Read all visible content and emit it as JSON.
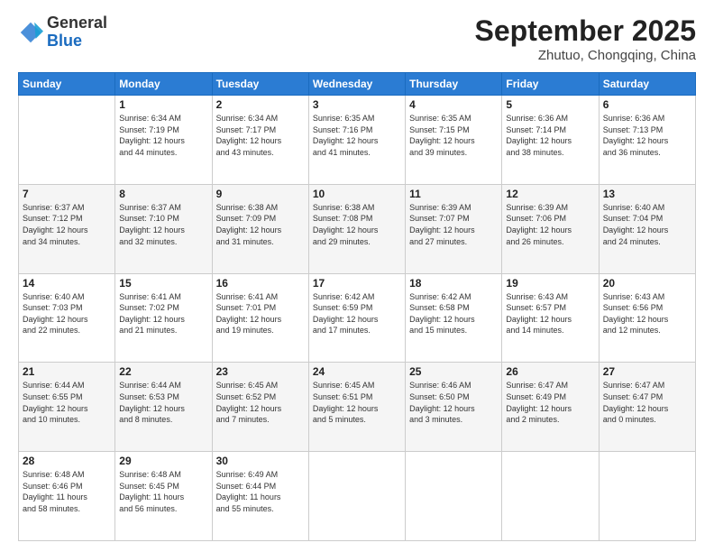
{
  "header": {
    "logo_general": "General",
    "logo_blue": "Blue",
    "month_year": "September 2025",
    "location": "Zhutuo, Chongqing, China"
  },
  "weekdays": [
    "Sunday",
    "Monday",
    "Tuesday",
    "Wednesday",
    "Thursday",
    "Friday",
    "Saturday"
  ],
  "weeks": [
    [
      {
        "day": "",
        "info": ""
      },
      {
        "day": "1",
        "info": "Sunrise: 6:34 AM\nSunset: 7:19 PM\nDaylight: 12 hours\nand 44 minutes."
      },
      {
        "day": "2",
        "info": "Sunrise: 6:34 AM\nSunset: 7:17 PM\nDaylight: 12 hours\nand 43 minutes."
      },
      {
        "day": "3",
        "info": "Sunrise: 6:35 AM\nSunset: 7:16 PM\nDaylight: 12 hours\nand 41 minutes."
      },
      {
        "day": "4",
        "info": "Sunrise: 6:35 AM\nSunset: 7:15 PM\nDaylight: 12 hours\nand 39 minutes."
      },
      {
        "day": "5",
        "info": "Sunrise: 6:36 AM\nSunset: 7:14 PM\nDaylight: 12 hours\nand 38 minutes."
      },
      {
        "day": "6",
        "info": "Sunrise: 6:36 AM\nSunset: 7:13 PM\nDaylight: 12 hours\nand 36 minutes."
      }
    ],
    [
      {
        "day": "7",
        "info": "Sunrise: 6:37 AM\nSunset: 7:12 PM\nDaylight: 12 hours\nand 34 minutes."
      },
      {
        "day": "8",
        "info": "Sunrise: 6:37 AM\nSunset: 7:10 PM\nDaylight: 12 hours\nand 32 minutes."
      },
      {
        "day": "9",
        "info": "Sunrise: 6:38 AM\nSunset: 7:09 PM\nDaylight: 12 hours\nand 31 minutes."
      },
      {
        "day": "10",
        "info": "Sunrise: 6:38 AM\nSunset: 7:08 PM\nDaylight: 12 hours\nand 29 minutes."
      },
      {
        "day": "11",
        "info": "Sunrise: 6:39 AM\nSunset: 7:07 PM\nDaylight: 12 hours\nand 27 minutes."
      },
      {
        "day": "12",
        "info": "Sunrise: 6:39 AM\nSunset: 7:06 PM\nDaylight: 12 hours\nand 26 minutes."
      },
      {
        "day": "13",
        "info": "Sunrise: 6:40 AM\nSunset: 7:04 PM\nDaylight: 12 hours\nand 24 minutes."
      }
    ],
    [
      {
        "day": "14",
        "info": "Sunrise: 6:40 AM\nSunset: 7:03 PM\nDaylight: 12 hours\nand 22 minutes."
      },
      {
        "day": "15",
        "info": "Sunrise: 6:41 AM\nSunset: 7:02 PM\nDaylight: 12 hours\nand 21 minutes."
      },
      {
        "day": "16",
        "info": "Sunrise: 6:41 AM\nSunset: 7:01 PM\nDaylight: 12 hours\nand 19 minutes."
      },
      {
        "day": "17",
        "info": "Sunrise: 6:42 AM\nSunset: 6:59 PM\nDaylight: 12 hours\nand 17 minutes."
      },
      {
        "day": "18",
        "info": "Sunrise: 6:42 AM\nSunset: 6:58 PM\nDaylight: 12 hours\nand 15 minutes."
      },
      {
        "day": "19",
        "info": "Sunrise: 6:43 AM\nSunset: 6:57 PM\nDaylight: 12 hours\nand 14 minutes."
      },
      {
        "day": "20",
        "info": "Sunrise: 6:43 AM\nSunset: 6:56 PM\nDaylight: 12 hours\nand 12 minutes."
      }
    ],
    [
      {
        "day": "21",
        "info": "Sunrise: 6:44 AM\nSunset: 6:55 PM\nDaylight: 12 hours\nand 10 minutes."
      },
      {
        "day": "22",
        "info": "Sunrise: 6:44 AM\nSunset: 6:53 PM\nDaylight: 12 hours\nand 8 minutes."
      },
      {
        "day": "23",
        "info": "Sunrise: 6:45 AM\nSunset: 6:52 PM\nDaylight: 12 hours\nand 7 minutes."
      },
      {
        "day": "24",
        "info": "Sunrise: 6:45 AM\nSunset: 6:51 PM\nDaylight: 12 hours\nand 5 minutes."
      },
      {
        "day": "25",
        "info": "Sunrise: 6:46 AM\nSunset: 6:50 PM\nDaylight: 12 hours\nand 3 minutes."
      },
      {
        "day": "26",
        "info": "Sunrise: 6:47 AM\nSunset: 6:49 PM\nDaylight: 12 hours\nand 2 minutes."
      },
      {
        "day": "27",
        "info": "Sunrise: 6:47 AM\nSunset: 6:47 PM\nDaylight: 12 hours\nand 0 minutes."
      }
    ],
    [
      {
        "day": "28",
        "info": "Sunrise: 6:48 AM\nSunset: 6:46 PM\nDaylight: 11 hours\nand 58 minutes."
      },
      {
        "day": "29",
        "info": "Sunrise: 6:48 AM\nSunset: 6:45 PM\nDaylight: 11 hours\nand 56 minutes."
      },
      {
        "day": "30",
        "info": "Sunrise: 6:49 AM\nSunset: 6:44 PM\nDaylight: 11 hours\nand 55 minutes."
      },
      {
        "day": "",
        "info": ""
      },
      {
        "day": "",
        "info": ""
      },
      {
        "day": "",
        "info": ""
      },
      {
        "day": "",
        "info": ""
      }
    ]
  ]
}
